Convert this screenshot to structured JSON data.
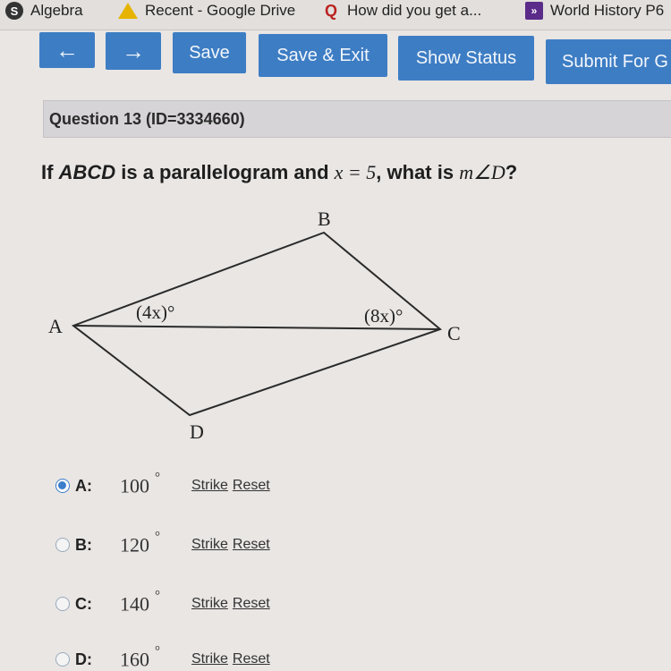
{
  "bookmarks": [
    {
      "label": "Algebra",
      "icon": "algebra-icon"
    },
    {
      "label": "Recent - Google Drive",
      "icon": "google-drive-icon"
    },
    {
      "label": "How did you get a...",
      "icon": "quora-icon"
    },
    {
      "label": "World History P6",
      "icon": "bookmark-arrow-icon"
    }
  ],
  "toolbar": {
    "back_label": "←",
    "forward_label": "→",
    "save_label": "Save",
    "save_exit_label": "Save & Exit",
    "show_status_label": "Show Status",
    "submit_label": "Submit For G"
  },
  "question": {
    "header": "Question 13 (ID=3334660)",
    "text_prefix": "If ",
    "text_italic": "ABCD",
    "text_middle": " is a parallelogram and ",
    "text_math1": "x = 5",
    "text_after": ", what is ",
    "text_math2": "m∠D",
    "text_end": "?"
  },
  "figure": {
    "vertices": {
      "A": "A",
      "B": "B",
      "C": "C",
      "D": "D"
    },
    "angle_label_A": "(4x)°",
    "angle_label_C": "(8x)°"
  },
  "choices": [
    {
      "letter": "A:",
      "value": "100",
      "unit": "°",
      "selected": true
    },
    {
      "letter": "B:",
      "value": "120",
      "unit": "°",
      "selected": false
    },
    {
      "letter": "C:",
      "value": "140",
      "unit": "°",
      "selected": false
    },
    {
      "letter": "D:",
      "value": "160",
      "unit": "°",
      "selected": false
    }
  ],
  "choice_actions": {
    "strike": "Strike",
    "reset": "Reset"
  },
  "colors": {
    "button_blue": "#3d7dc4",
    "radio_selected": "#3b7ecb"
  }
}
